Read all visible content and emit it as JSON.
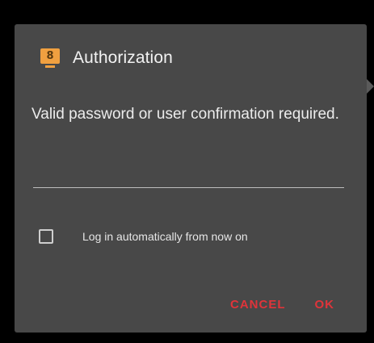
{
  "dialog": {
    "title": "Authorization",
    "icon": "computer-icon",
    "icon_glyph": "8",
    "message": "Valid password or user confirmation required.",
    "password_value": "",
    "checkbox_label": "Log in automatically from now on",
    "checkbox_checked": false,
    "cancel_label": "CANCEL",
    "ok_label": "OK"
  },
  "colors": {
    "background": "#000000",
    "dialog_background": "#484848",
    "accent_icon": "#f0a040",
    "button_text": "#e0343a",
    "text_primary": "#f2f2f2"
  }
}
